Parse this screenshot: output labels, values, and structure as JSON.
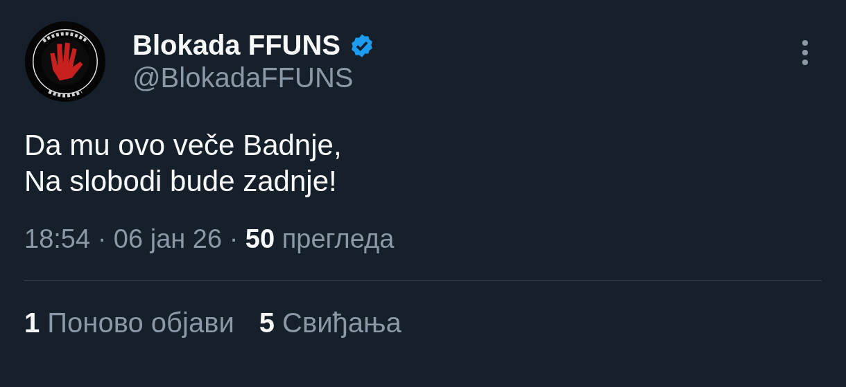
{
  "author": {
    "name": "Blokada FFUNS",
    "verified": true,
    "handle": "@BlokadaFFUNS"
  },
  "post": {
    "lines": [
      "Da mu ovo veče Badnje,",
      "Na slobodi bude zadnje!"
    ]
  },
  "meta": "18:54 · 06 јан 26 · **50** прегледа",
  "stats": [
    "**1** Поново објави",
    "**5** Свиђања"
  ]
}
